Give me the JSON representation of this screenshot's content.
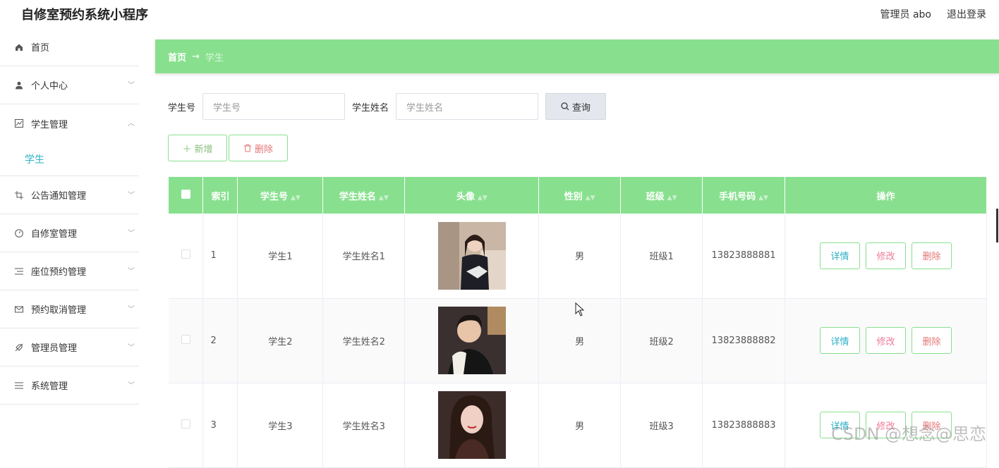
{
  "app": {
    "title": "自修室预约系统小程序"
  },
  "header": {
    "user": "管理员 abo",
    "logout": "退出登录"
  },
  "sidebar": {
    "items": [
      {
        "label": "首页",
        "icon": "home-icon"
      },
      {
        "label": "个人中心",
        "icon": "user-icon"
      },
      {
        "label": "学生管理",
        "icon": "chart-icon"
      },
      {
        "label": "公告通知管理",
        "icon": "crop-icon"
      },
      {
        "label": "自修室管理",
        "icon": "compass-icon"
      },
      {
        "label": "座位预约管理",
        "icon": "list-icon"
      },
      {
        "label": "预约取消管理",
        "icon": "mail-icon"
      },
      {
        "label": "管理员管理",
        "icon": "tag-off-icon"
      },
      {
        "label": "系统管理",
        "icon": "menu-icon"
      }
    ],
    "sub_item": "学生"
  },
  "breadcrumb": {
    "home": "首页",
    "arrow": "→",
    "current": "学生"
  },
  "search": {
    "field1_label": "学生号",
    "field1_placeholder": "学生号",
    "field2_label": "学生姓名",
    "field2_placeholder": "学生姓名",
    "query": "查询"
  },
  "actions": {
    "add": "新增",
    "delete": "删除"
  },
  "table": {
    "headers": [
      "索引",
      "学生号",
      "学生姓名",
      "头像",
      "性别",
      "班级",
      "手机号码",
      "操作"
    ],
    "rows": [
      {
        "index": "1",
        "student_no": "学生1",
        "name": "学生姓名1",
        "gender": "男",
        "class": "班级1",
        "phone": "13823888881"
      },
      {
        "index": "2",
        "student_no": "学生2",
        "name": "学生姓名2",
        "gender": "男",
        "class": "班级2",
        "phone": "13823888882"
      },
      {
        "index": "3",
        "student_no": "学生3",
        "name": "学生姓名3",
        "gender": "男",
        "class": "班级3",
        "phone": "13823888883"
      }
    ],
    "row_actions": {
      "detail": "详情",
      "edit": "修改",
      "remove": "删除"
    }
  },
  "watermark": "CSDN @想念@思恋",
  "colors": {
    "accent": "#88e08e",
    "link": "#2bb0c6",
    "edit": "#f07a9a",
    "danger": "#e67676"
  }
}
